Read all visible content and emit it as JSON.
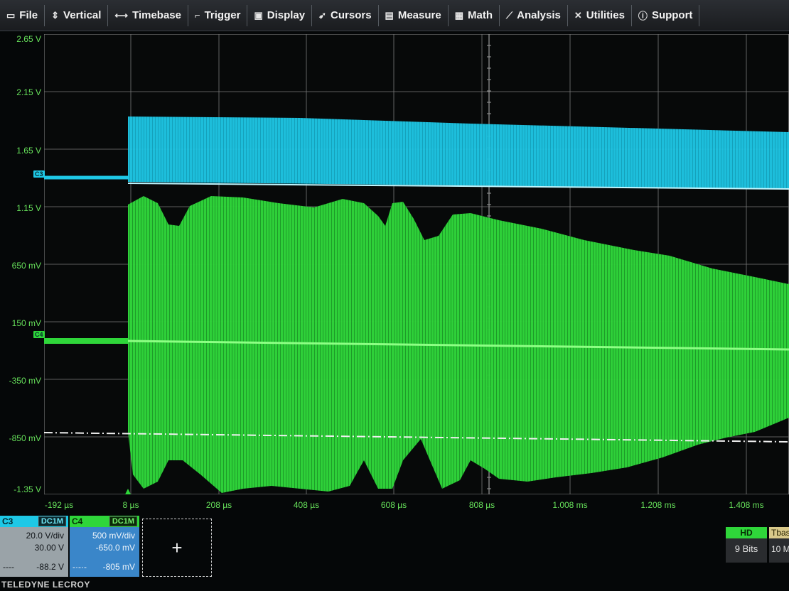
{
  "menu": [
    {
      "label": "File",
      "icon": "file-icon"
    },
    {
      "label": "Vertical",
      "icon": "vertical-icon"
    },
    {
      "label": "Timebase",
      "icon": "timebase-icon"
    },
    {
      "label": "Trigger",
      "icon": "trigger-icon"
    },
    {
      "label": "Display",
      "icon": "display-icon"
    },
    {
      "label": "Cursors",
      "icon": "cursors-icon"
    },
    {
      "label": "Measure",
      "icon": "measure-icon"
    },
    {
      "label": "Math",
      "icon": "math-icon"
    },
    {
      "label": "Analysis",
      "icon": "analysis-icon"
    },
    {
      "label": "Utilities",
      "icon": "utilities-icon"
    },
    {
      "label": "Support",
      "icon": "support-icon"
    }
  ],
  "y_axis": [
    "2.65 V",
    "2.15 V",
    "1.65 V",
    "1.15 V",
    "650 mV",
    "150 mV",
    "-350 mV",
    "-850 mV",
    "-1.35 V"
  ],
  "x_axis": [
    "-192 µs",
    "8 µs",
    "208 µs",
    "408 µs",
    "608 µs",
    "808 µs",
    "1.008 ms",
    "1.208 ms",
    "1.408 ms"
  ],
  "markers": {
    "c3": "C3",
    "c4": "C4"
  },
  "colors": {
    "c3": "#1ec8e6",
    "c4": "#2fd63a",
    "axis_label": "#66e05a",
    "trigger": "#2fd63a"
  },
  "channels": {
    "c3": {
      "name": "C3",
      "coupling": "DC1M",
      "vdiv": "20.0 V/div",
      "offset": "30.00 V",
      "reading": "-88.2 V",
      "reading_prefix": "----"
    },
    "c4": {
      "name": "C4",
      "coupling": "DC1M",
      "vdiv": "500 mV/div",
      "offset": "-650.0 mV",
      "reading": "-805 mV",
      "reading_prefix": "-·-·-"
    }
  },
  "add_button": "+",
  "acquisition": {
    "hd_label": "HD",
    "bits": "9 Bits"
  },
  "timebase": {
    "label": "Tbase",
    "value": "10 M"
  },
  "brand": "TELEDYNE LECROY"
}
